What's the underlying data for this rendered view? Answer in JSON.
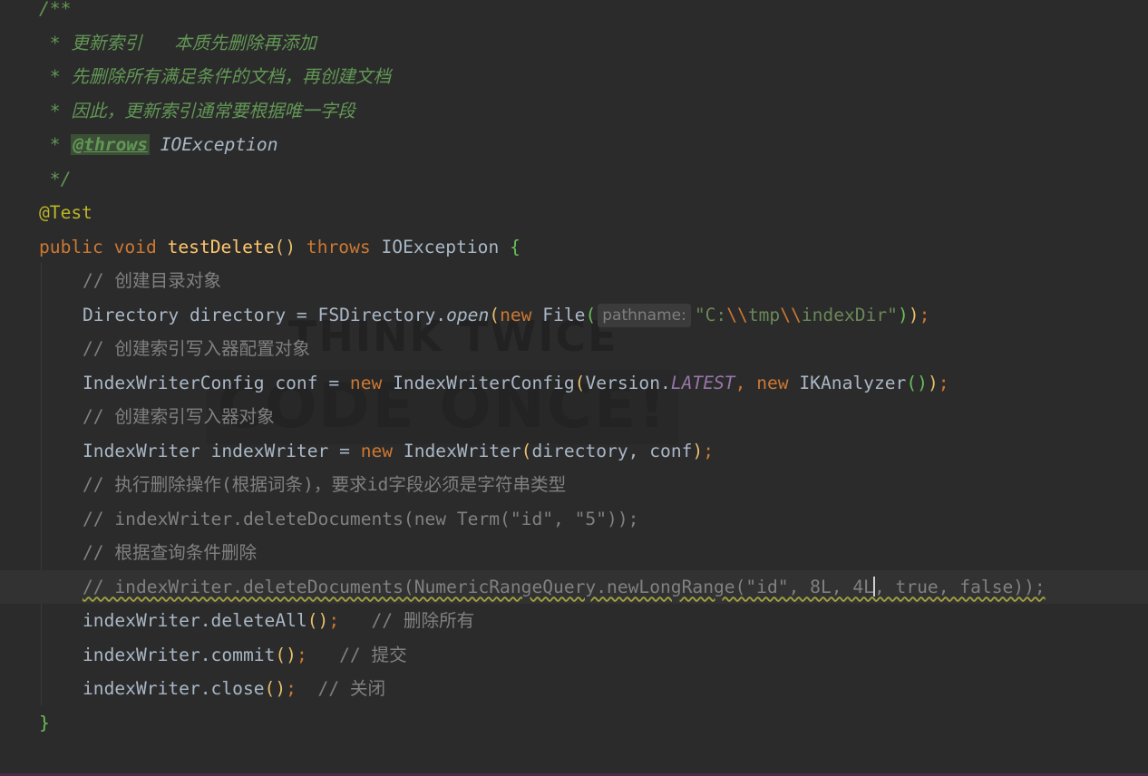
{
  "doc_comment": {
    "open": "/**",
    "lines": [
      " * 更新索引   本质先删除再添加",
      " * 先删除所有满足条件的文档，再创建文档",
      " * 因此，更新索引通常要根据唯一字段"
    ],
    "throws_prefix": " * ",
    "throws_tag": "@throws",
    "throws_type": "IOException",
    "close": " */"
  },
  "annotation": "@Test",
  "method_signature": {
    "public": "public",
    "void": "void",
    "name": "testDelete",
    "parens": "()",
    "throws": "throws",
    "exception": "IOException",
    "open_brace": "{"
  },
  "body": {
    "comment_create_dir": "// 创建目录对象",
    "dir_type": "Directory",
    "dir_var": "directory",
    "fs_class": "FSDirectory.",
    "open_method": "open",
    "new_kw": "new",
    "file_class": "File",
    "param_hint": "pathname:",
    "path_part1": "\"C:",
    "path_escape1": "\\\\",
    "path_part2": "tmp",
    "path_escape2": "\\\\",
    "path_part3": "indexDir\"",
    "comment_config": "// 创建索引写入器配置对象",
    "config_type": "IndexWriterConfig",
    "config_var": "conf",
    "config_class": "IndexWriterConfig",
    "version_class": "Version.",
    "latest_field": "LATEST",
    "analyzer_class": "IKAnalyzer",
    "comment_writer": "// 创建索引写入器对象",
    "writer_type": "IndexWriter",
    "writer_var": "indexWriter",
    "writer_class": "IndexWriter",
    "writer_args": "directory, conf",
    "comment_delete_term": "// 执行删除操作(根据词条)，要求id字段必须是字符串类型",
    "comment_delete_term_code": "// indexWriter.deleteDocuments(new Term(\"id\", \"5\"));",
    "comment_delete_query": "// 根据查询条件删除",
    "comment_delete_query_code_a": "// indexWriter.deleteDocuments(NumericRangeQuery.newLongRange(\"id\", 8L, 4L",
    "comment_delete_query_code_b": ", true, false));",
    "delete_all_call": "indexWriter.deleteAll",
    "delete_all_comment": "// 删除所有",
    "commit_call": "indexWriter.commit",
    "commit_comment": "// 提交",
    "close_call": "indexWriter.close",
    "close_comment": "// 关闭",
    "close_brace": "}"
  },
  "watermark": {
    "line1": "THINK TWICE",
    "line2": "CODE ONCE!"
  },
  "colors": {
    "background": "#2b2b2b",
    "keyword": "#cc7832",
    "string": "#6a8759",
    "comment": "#808080",
    "doc_comment": "#629755",
    "method_declaration": "#ffc66d",
    "annotation": "#bbb529",
    "static_field": "#9876aa"
  }
}
